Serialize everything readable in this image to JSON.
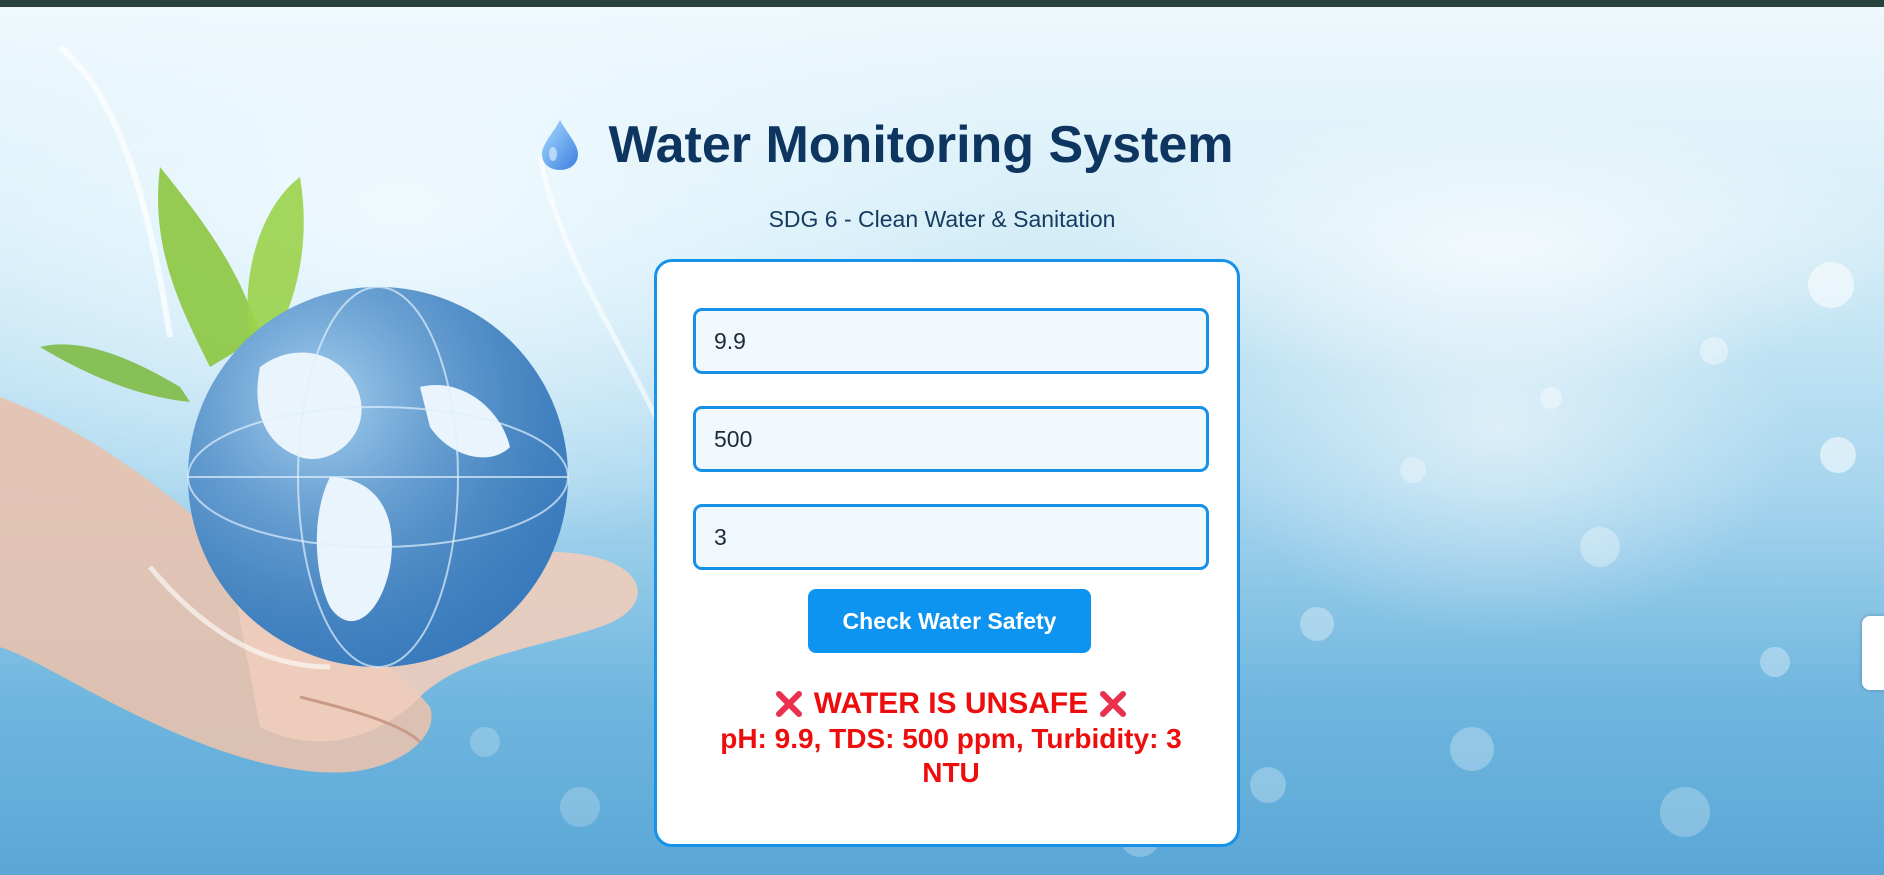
{
  "header": {
    "title": "Water Monitoring System",
    "subtitle": "SDG 6 - Clean Water & Sanitation",
    "title_icon": "water-drop-icon"
  },
  "form": {
    "ph_value": "9.9",
    "tds_value": "500",
    "turbidity_value": "3",
    "check_label": "Check Water Safety"
  },
  "result": {
    "status": "WATER IS UNSAFE",
    "details": "pH: 9.9, TDS: 500 ppm, Turbidity: 3 NTU",
    "status_icon": "cross-mark-icon"
  },
  "colors": {
    "accent": "#0d94f0",
    "title": "#0d3560",
    "danger": "#ee0d0d"
  }
}
